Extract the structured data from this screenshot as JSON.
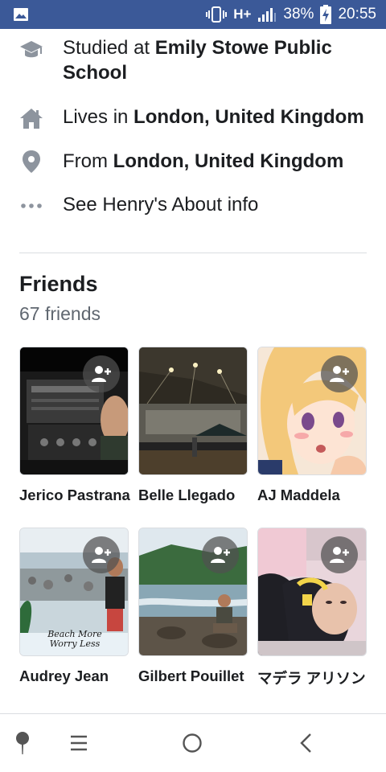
{
  "status_bar": {
    "network": "H+",
    "battery": "38%",
    "time": "20:55"
  },
  "intro": {
    "studied_prefix": "Studied at ",
    "studied_school": "Emily Stowe Public School",
    "lives_prefix": "Lives in ",
    "lives_place": "London, United Kingdom",
    "from_prefix": "From ",
    "from_place": "London, United Kingdom",
    "about_link": "See Henry's About info"
  },
  "friends": {
    "title": "Friends",
    "count": "67 friends",
    "list": [
      {
        "name": "Jerico Pastrana",
        "add_friend": true
      },
      {
        "name": "Belle Llegado",
        "add_friend": false
      },
      {
        "name": "AJ Maddela",
        "add_friend": true
      },
      {
        "name": "Audrey Jean",
        "add_friend": true
      },
      {
        "name": "Gilbert Pouillet",
        "add_friend": true
      },
      {
        "name": "マデラ アリソン",
        "add_friend": true
      }
    ],
    "photo3_caption": "Beach More Worry Less"
  },
  "icons": {
    "school": "graduation-cap-icon",
    "home": "house-icon",
    "location": "map-pin-icon",
    "more": "more-dots-icon",
    "add_friend": "add-friend-icon"
  },
  "colors": {
    "status_bar": "#3b5998",
    "icon_gray": "#8d949e",
    "secondary_text": "#606770"
  }
}
